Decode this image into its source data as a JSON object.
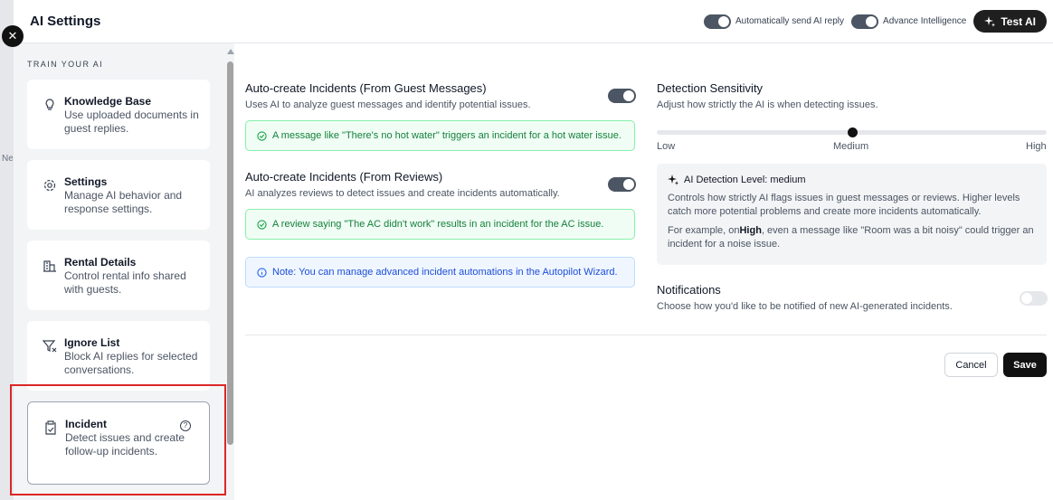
{
  "header": {
    "title": "AI Settings",
    "auto_send_label": "Automatically send AI reply",
    "advance_label": "Advance Intelligence",
    "test_label": "Test AI"
  },
  "sidebar": {
    "heading": "TRAIN YOUR AI",
    "items": [
      {
        "title": "Knowledge Base",
        "desc": "Use uploaded documents in guest replies."
      },
      {
        "title": "Settings",
        "desc": "Manage AI behavior and response settings."
      },
      {
        "title": "Rental Details",
        "desc": "Control rental info shared with guests."
      },
      {
        "title": "Ignore List",
        "desc": "Block AI replies for selected conversations."
      },
      {
        "title": "Incident",
        "desc": "Detect issues and create follow-up incidents."
      }
    ]
  },
  "incidents": {
    "guest_title": "Auto-create Incidents (From Guest Messages)",
    "guest_desc": "Uses AI to analyze guest messages and identify potential issues.",
    "guest_example": "A message like \"There's no hot water\" triggers an incident for a hot water issue.",
    "review_title": "Auto-create Incidents (From Reviews)",
    "review_desc": "AI analyzes reviews to detect issues and create incidents automatically.",
    "review_example": "A review saying \"The AC didn't work\" results in an incident for the AC issue.",
    "note": "Note: You can manage advanced incident automations in the Autopilot Wizard."
  },
  "sensitivity": {
    "title": "Detection Sensitivity",
    "desc": "Adjust how strictly the AI is when detecting issues.",
    "low": "Low",
    "medium": "Medium",
    "high": "High",
    "value_fraction": 0.5,
    "info_title": "AI Detection Level: medium",
    "info_p1": "Controls how strictly AI flags issues in guest messages or reviews. Higher levels catch more potential problems and create more incidents automatically.",
    "info_p2_prefix": "For example, on",
    "info_p2_bold": "High",
    "info_p2_suffix": ", even a message like \"Room was a bit noisy\" could trigger an incident for a noise issue."
  },
  "notifications": {
    "title": "Notifications",
    "desc": "Choose how you'd like to be notified of new AI-generated incidents."
  },
  "actions": {
    "cancel": "Cancel",
    "save": "Save"
  }
}
